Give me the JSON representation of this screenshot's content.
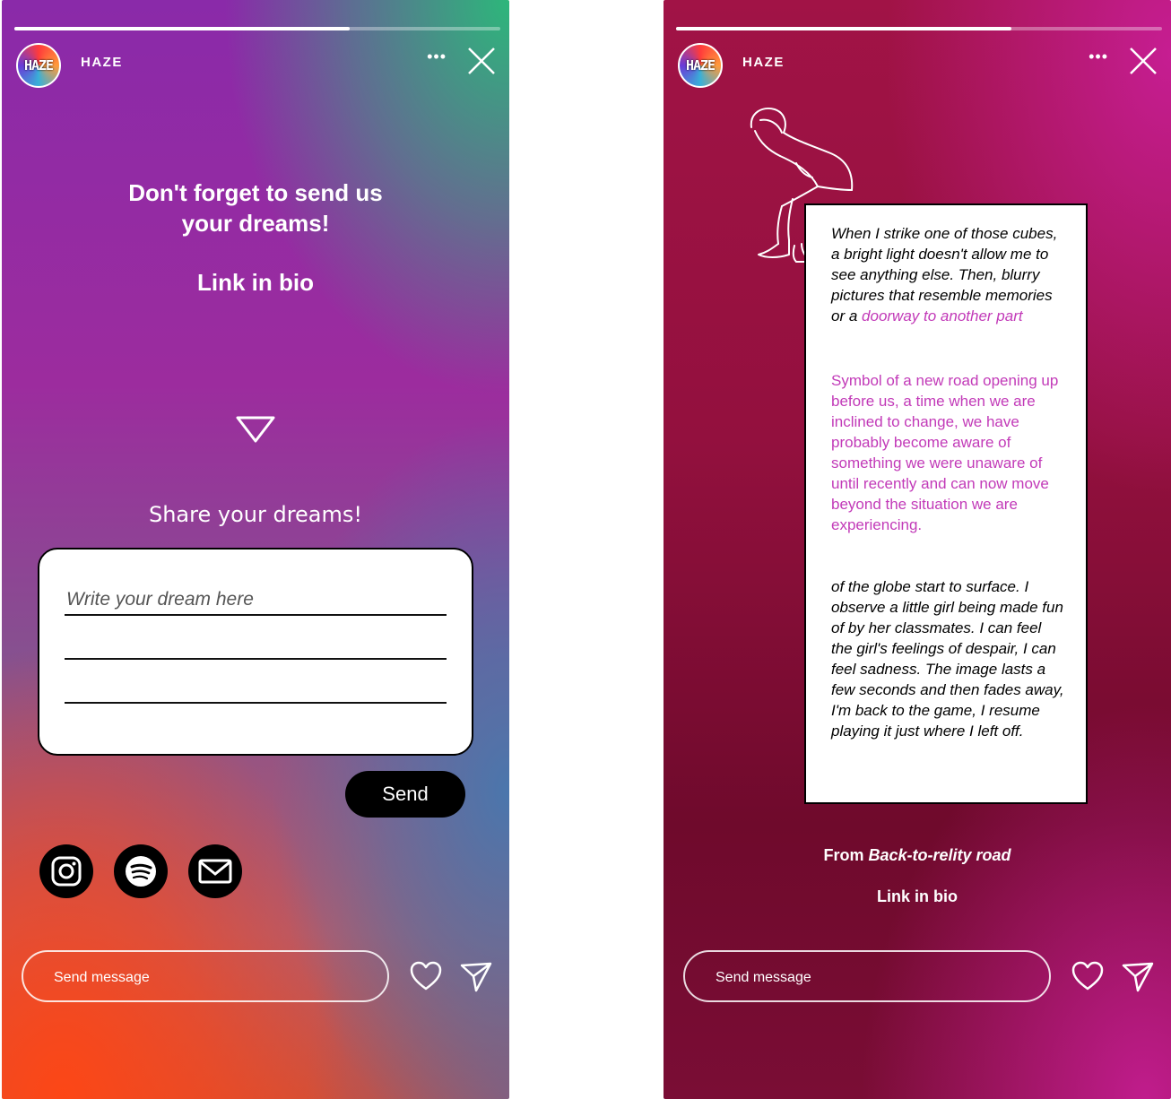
{
  "account": {
    "name": "HAZE",
    "avatar_text": "HAZE"
  },
  "left_story": {
    "progress": 0.69,
    "headline_line1": "Don't forget to send us",
    "headline_line2": "your dreams!",
    "link_in_bio": "Link in bio",
    "share_title": "Share your dreams!",
    "dream_placeholder": "Write your dream here",
    "send_label": "Send",
    "socials": [
      "instagram-icon",
      "spotify-icon",
      "mail-icon"
    ],
    "message_placeholder": "Send message"
  },
  "right_story": {
    "progress": 0.69,
    "quote_part1": "When I strike one of those cubes, a bright light doesn't allow me to see anything else. Then, blurry pictures that resemble memories or a",
    "quote_part1_pink": "doorway to another part",
    "quote_part2": "Symbol of a new road opening up before us, a time when we are inclined to change, we have probably become aware of something we were unaware of until recently and can now move beyond the situation we are experiencing.",
    "quote_part3": "of the globe start to surface. I observe a little girl being made fun of by her classmates. I can feel the girl's feelings of despair, I can feel sadness. The image lasts a few seconds and then fades away, I'm back to the game, I resume playing it just where I left off.",
    "from_prefix": "From ",
    "from_title": "Back-to-relity road",
    "link_in_bio": "Link in bio",
    "message_placeholder": "Send message"
  }
}
